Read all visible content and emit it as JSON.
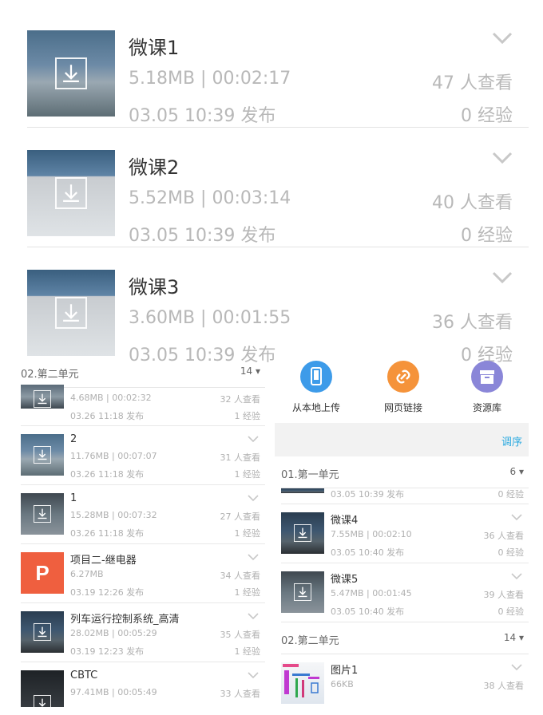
{
  "top_list": [
    {
      "title": "微课1",
      "meta": "5.18MB | 00:02:17",
      "date": "03.05 10:39 发布",
      "views": "47 人查看",
      "exp": "0 经验"
    },
    {
      "title": "微课2",
      "meta": "5.52MB | 00:03:14",
      "date": "03.05 10:39 发布",
      "views": "40 人查看",
      "exp": "0 经验"
    },
    {
      "title": "微课3",
      "meta": "3.60MB | 00:01:55",
      "date": "03.05 10:39 发布",
      "views": "36 人查看",
      "exp": "0 经验"
    }
  ],
  "left_panel": {
    "section_label": "02.第二单元",
    "section_count": "14",
    "items": [
      {
        "title": "",
        "meta": "4.68MB | 00:02:32",
        "date": "03.26 11:18 发布",
        "views": "32 人查看",
        "exp": "1 经验"
      },
      {
        "title": "2",
        "meta": "11.76MB | 00:07:07",
        "date": "03.26 11:18 发布",
        "views": "31 人查看",
        "exp": "1 经验"
      },
      {
        "title": "1",
        "meta": "15.28MB | 00:07:32",
        "date": "03.26 11:18 发布",
        "views": "27 人查看",
        "exp": "1 经验"
      },
      {
        "title": "项目二-继电器",
        "meta": "6.27MB",
        "date": "03.19 12:26 发布",
        "views": "34 人查看",
        "exp": "1 经验",
        "thumb_letter": "P"
      },
      {
        "title": "列车运行控制系统_高清",
        "meta": "28.02MB | 00:05:29",
        "date": "03.19 12:23 发布",
        "views": "35 人查看",
        "exp": "1 经验"
      },
      {
        "title": "CBTC",
        "meta": "97.41MB | 00:05:49",
        "date": "",
        "views": "33 人查看",
        "exp": ""
      }
    ]
  },
  "right_panel": {
    "actions": [
      {
        "label": "从本地上传",
        "icon": "phone-upload-icon",
        "color": "#3d9be9"
      },
      {
        "label": "网页链接",
        "icon": "link-icon",
        "color": "#f5933a"
      },
      {
        "label": "资源库",
        "icon": "archive-icon",
        "color": "#8a86d8"
      }
    ],
    "sort_label": "调序",
    "section1": {
      "label": "01.第一单元",
      "count": "6"
    },
    "partial_row": {
      "date": "03.05 10:39 发布",
      "exp": "0 经验"
    },
    "items": [
      {
        "title": "微课4",
        "meta": "7.55MB | 00:02:10",
        "date": "03.05 10:40 发布",
        "views": "36 人查看",
        "exp": "0 经验"
      },
      {
        "title": "微课5",
        "meta": "5.47MB | 00:01:45",
        "date": "03.05 10:40 发布",
        "views": "39 人查看",
        "exp": "0 经验"
      }
    ],
    "section2": {
      "label": "02.第二单元",
      "count": "14"
    },
    "last_item": {
      "title": "图片1",
      "meta": "66KB",
      "date": "",
      "views": "38 人查看",
      "exp": ""
    }
  },
  "colors": {
    "accent_blue": "#2aa9e0",
    "ppt_orange": "#ef5f3f",
    "muted_text": "#b8b8b8"
  }
}
